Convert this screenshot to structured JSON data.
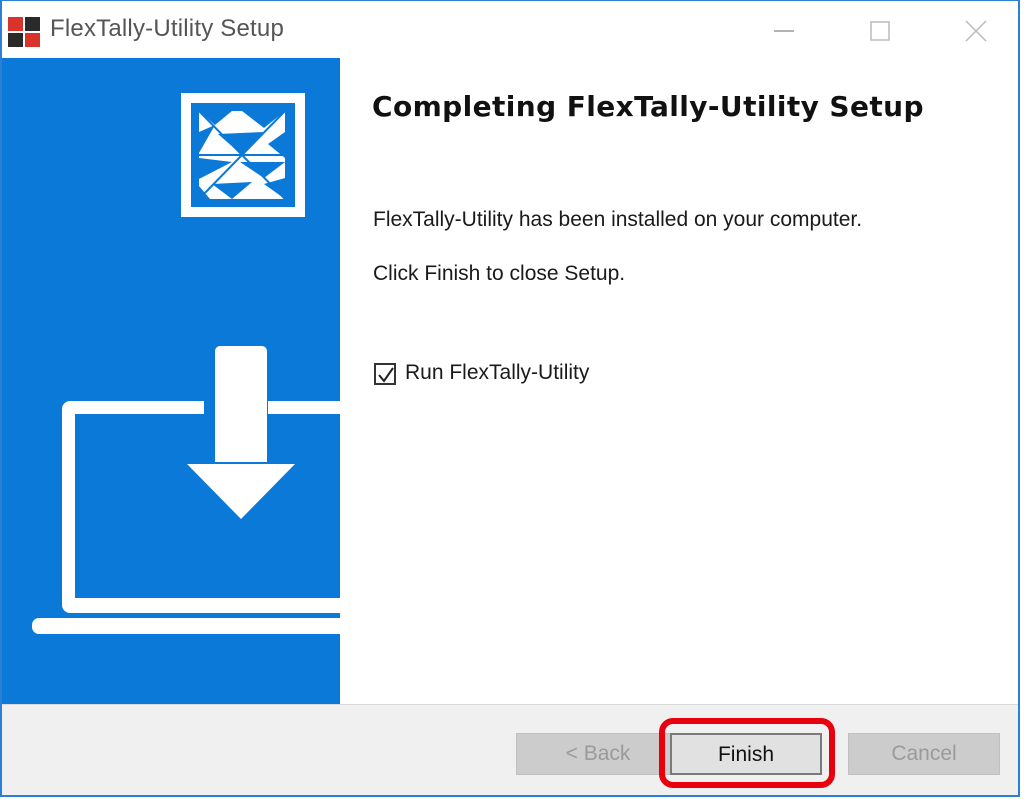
{
  "window": {
    "title": "FlexTally-Utility Setup",
    "app_icon": "installer-app-icon",
    "controls": [
      "minimize-icon",
      "maximize-icon",
      "close-icon"
    ]
  },
  "sidebar": {
    "accent_color": "#0b79d8",
    "logo_icon": "flextally-logo-icon",
    "illustration": "download-to-laptop-icon"
  },
  "content": {
    "heading": "Completing FlexTally-Utility Setup",
    "installed_message": "FlexTally-Utility has been installed on your computer.",
    "finish_message": "Click Finish to close Setup.",
    "run_option": {
      "label": "Run FlexTally-Utility",
      "checked": true
    }
  },
  "footer": {
    "back_label": "< Back",
    "finish_label": "Finish",
    "cancel_label": "Cancel",
    "highlight_color": "#e8000d"
  }
}
